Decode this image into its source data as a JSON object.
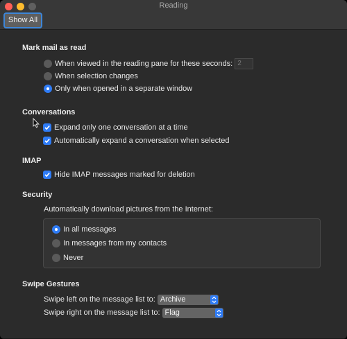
{
  "window": {
    "title": "Reading"
  },
  "toolbar": {
    "show_all_label": "Show All"
  },
  "mark_read": {
    "heading": "Mark mail as read",
    "options": [
      {
        "label": "When viewed in the reading pane for these seconds:",
        "selected": false
      },
      {
        "label": "When selection changes",
        "selected": false
      },
      {
        "label": "Only when opened in a separate window",
        "selected": true
      }
    ],
    "seconds_value": "2"
  },
  "conversations": {
    "heading": "Conversations",
    "options": [
      {
        "label": "Expand only one conversation at a time",
        "checked": true
      },
      {
        "label": "Automatically expand a conversation when selected",
        "checked": true
      }
    ]
  },
  "imap": {
    "heading": "IMAP",
    "options": [
      {
        "label": "Hide IMAP messages marked for deletion",
        "checked": true
      }
    ]
  },
  "security": {
    "heading": "Security",
    "description": "Automatically download pictures from the Internet:",
    "options": [
      {
        "label": "In all messages",
        "selected": true
      },
      {
        "label": "In messages from my contacts",
        "selected": false
      },
      {
        "label": "Never",
        "selected": false
      }
    ]
  },
  "swipe": {
    "heading": "Swipe Gestures",
    "left_label": "Swipe left on the message list to:",
    "left_value": "Archive",
    "right_label": "Swipe right on the message list to:",
    "right_value": "Flag"
  },
  "colors": {
    "accent": "#2f7cf6",
    "background": "#2b2b2b",
    "titlebar": "#383838"
  }
}
